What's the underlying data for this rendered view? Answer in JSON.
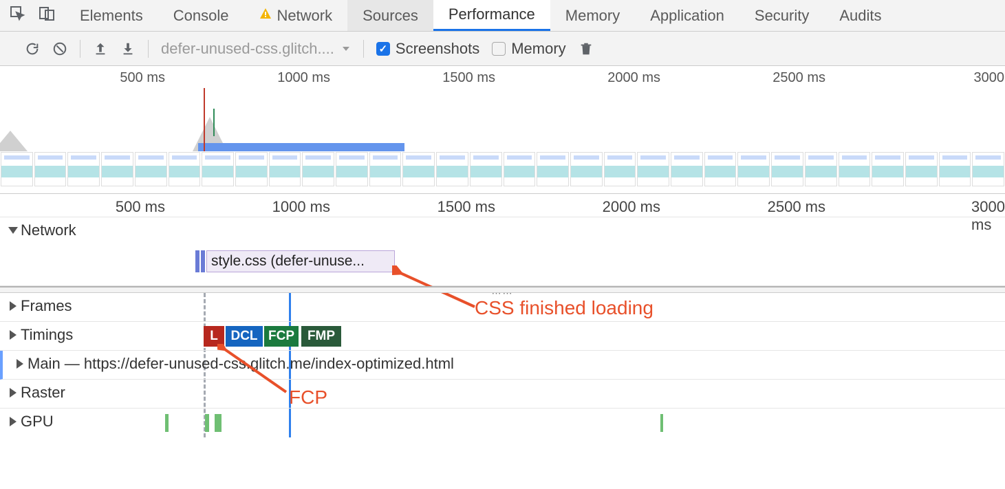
{
  "tabs": {
    "elements": "Elements",
    "console": "Console",
    "network": "Network",
    "sources": "Sources",
    "performance": "Performance",
    "memory": "Memory",
    "application": "Application",
    "security": "Security",
    "audits": "Audits"
  },
  "toolbar": {
    "dropdown": "defer-unused-css.glitch....",
    "screenshots": "Screenshots",
    "memory": "Memory"
  },
  "overview_ruler": {
    "t500": "500 ms",
    "t1000": "1000 ms",
    "t1500": "1500 ms",
    "t2000": "2000 ms",
    "t2500": "2500 ms",
    "t3000": "3000"
  },
  "detail_ruler": {
    "t500": "500 ms",
    "t1000": "1000 ms",
    "t1500": "1500 ms",
    "t2000": "2000 ms",
    "t2500": "2500 ms",
    "t3000": "3000 ms"
  },
  "tracks": {
    "network": "Network",
    "network_item": "style.css (defer-unuse...",
    "frames": "Frames",
    "timings": "Timings",
    "main": "Main — https://defer-unused-css.glitch.me/index-optimized.html",
    "raster": "Raster",
    "gpu": "GPU"
  },
  "timings": {
    "l": "L",
    "dcl": "DCL",
    "fcp": "FCP",
    "fmp": "FMP"
  },
  "annotations": {
    "css": "CSS finished loading",
    "fcp": "FCP"
  }
}
